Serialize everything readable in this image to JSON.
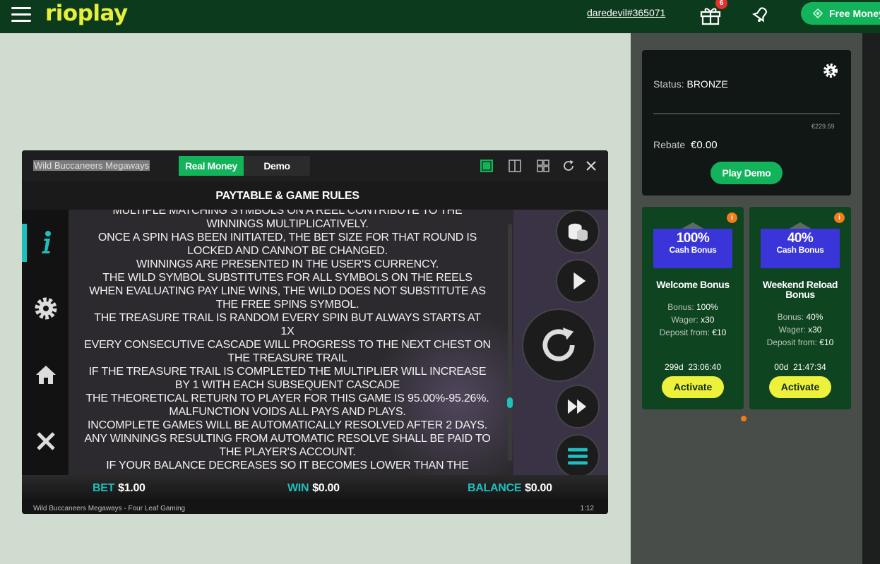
{
  "header": {
    "logo": "rioplay",
    "username": "daredevil#365071",
    "gift_count": "6",
    "free_money_label": "Free Money"
  },
  "status_card": {
    "status_label": "Status:",
    "status_value": "BRONZE",
    "progress_value": "€229.59",
    "rebate_label": "Rebate",
    "rebate_value": "€0.00",
    "play_demo_label": "Play Demo"
  },
  "bonuses": [
    {
      "percent": "100%",
      "badge_sub": "Cash Bonus",
      "name": "Welcome Bonus",
      "bonus_label": "Bonus:",
      "bonus_value": "100%",
      "wager_label": "Wager:",
      "wager_value": "x30",
      "deposit_label": "Deposit from:",
      "deposit_value": "€10",
      "timer": "299d  23:06:40",
      "activate_label": "Activate"
    },
    {
      "percent": "40%",
      "badge_sub": "Cash Bonus",
      "name": "Weekend Reload Bonus",
      "bonus_label": "Bonus:",
      "bonus_value": "40%",
      "wager_label": "Wager:",
      "wager_value": "x30",
      "deposit_label": "Deposit from:",
      "deposit_value": "€10",
      "timer": "00d  21:47:34",
      "activate_label": "Activate"
    }
  ],
  "game": {
    "title": "Wild Buccaneers Megaways",
    "mode_real": "Real Money",
    "mode_demo": "Demo",
    "paytable_title": "PAYTABLE & GAME RULES",
    "rules_lines": [
      "MULTIPLE MATCHING SYMBOLS ON A REEL CONTRIBUTE TO THE",
      "WINNINGS MULTIPLICATIVELY.",
      "ONCE A SPIN HAS BEEN INITIATED, THE BET SIZE FOR THAT ROUND IS",
      "LOCKED AND CANNOT BE CHANGED.",
      "WINNINGS ARE PRESENTED IN THE USER'S CURRENCY.",
      "THE WILD SYMBOL SUBSTITUTES FOR ALL SYMBOLS ON THE REELS",
      "WHEN EVALUATING PAY LINE WINS, THE WILD DOES NOT SUBSTITUTE AS",
      "THE FREE SPINS SYMBOL.",
      "THE TREASURE TRAIL IS RANDOM EVERY SPIN BUT ALWAYS STARTS AT",
      "1X",
      "EVERY CONSECUTIVE CASCADE WILL PROGRESS TO THE NEXT CHEST ON",
      "THE TREASURE TRAIL",
      "IF THE TREASURE TRAIL IS COMPLETED THE MULTIPLIER WILL INCREASE",
      "BY 1 WITH EACH SUBSEQUENT CASCADE",
      "THE THEORETICAL RETURN TO PLAYER FOR THIS GAME IS 95.00%-95.26%.",
      "MALFUNCTION VOIDS ALL PAYS AND PLAYS.",
      "INCOMPLETE GAMES WILL BE AUTOMATICALLY RESOLVED AFTER 2 DAYS.",
      "ANY WINNINGS RESULTING FROM AUTOMATIC RESOLVE SHALL BE PAID TO",
      "THE PLAYER'S ACCOUNT.",
      "IF YOUR BALANCE DECREASES SO IT BECOMES LOWER THAN THE"
    ],
    "bet_label": "BET",
    "bet_value": "$1.00",
    "win_label": "WIN",
    "win_value": "$0.00",
    "balance_label": "BALANCE",
    "balance_value": "$0.00",
    "footer_left": "Wild Buccaneers Megaways - Four Leaf Gaming",
    "footer_right": "1:12"
  },
  "colors": {
    "header_bg": "#0c3a1d",
    "brand_green": "#12b35a",
    "logo_yellow": "#e6ef3c",
    "accent_teal": "#1fbfbf",
    "badge_blue": "#3a35d8",
    "activate_yellow": "#eef13b",
    "info_orange": "#f07c1a"
  },
  "icons": [
    "menu-icon",
    "gift-icon",
    "bell-icon",
    "free-money-icon",
    "gear-dollar-icon",
    "fullscreen-icon",
    "split-icon",
    "grid-icon",
    "refresh-icon",
    "close-icon",
    "info-icon",
    "settings-icon",
    "home-icon",
    "exit-icon",
    "coins-icon",
    "play-icon",
    "spin-icon",
    "fast-forward-icon",
    "menu-lines-icon"
  ]
}
